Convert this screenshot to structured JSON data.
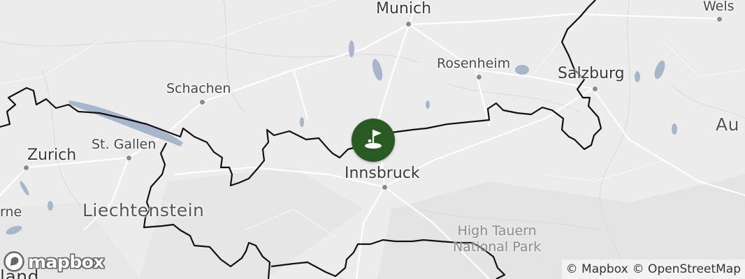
{
  "cities": {
    "munich": "Munich",
    "wels": "Wels",
    "rosenheim": "Rosenheim",
    "salzburg": "Salzburg",
    "schachen": "Schachen",
    "st_gallen": "St. Gallen",
    "zurich": "Zurich",
    "innsbruck": "Innsbruck",
    "berne_partial": "rne",
    "land_partial": "land"
  },
  "countries": {
    "liechtenstein": "Liechtenstein",
    "austria_partial": "Au"
  },
  "parks": {
    "high_tauern_line1": "High Tauern",
    "high_tauern_line2": "National Park"
  },
  "marker": {
    "icon": "golf-flag-icon",
    "color": "#2a5a23"
  },
  "logo": {
    "text": "mapbox"
  },
  "attribution": {
    "mapbox": "© Mapbox",
    "osm": "© OpenStreetMap"
  },
  "colors": {
    "land": "#ececec",
    "water": "#a8b6cb",
    "border": "#111111",
    "roads": "#ffffff"
  }
}
